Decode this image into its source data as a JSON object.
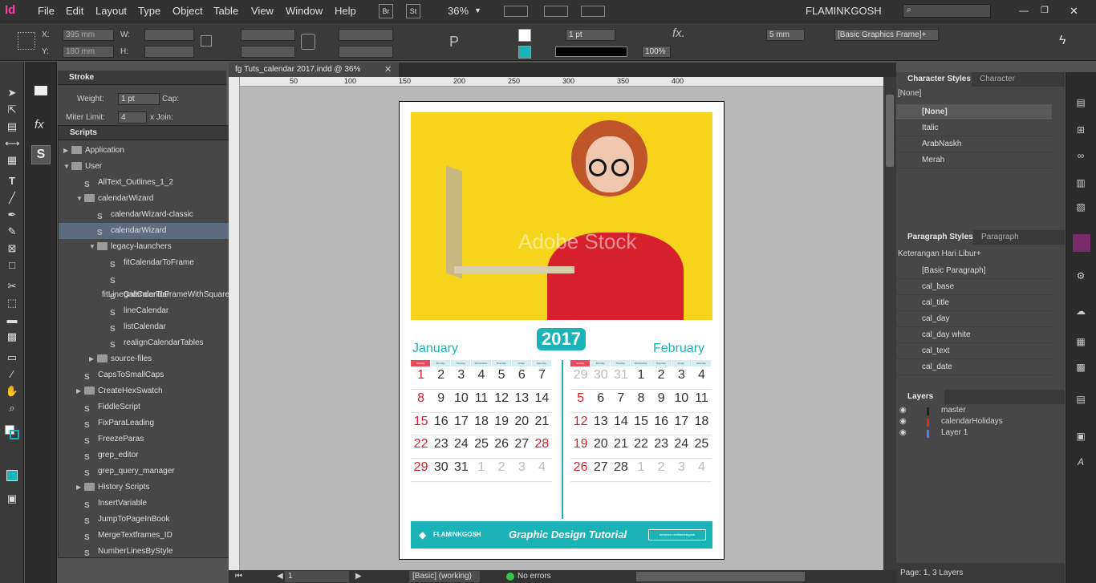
{
  "app": {
    "logo": "Id",
    "zoom": "36%",
    "workspace": "FLAMINKGOSH",
    "bridge_btn": "Br",
    "stock_btn": "St"
  },
  "menu": [
    "File",
    "Edit",
    "Layout",
    "Type",
    "Object",
    "Table",
    "View",
    "Window",
    "Help"
  ],
  "control": {
    "x_label": "X:",
    "x_value": "395 mm",
    "y_label": "Y:",
    "y_value": "180 mm",
    "w_label": "W:",
    "h_label": "H:",
    "stroke_weight": "1 pt",
    "stroke_weight_right": "5 mm",
    "frame_style": "[Basic Graphics Frame]+",
    "opacity": "100%"
  },
  "stroke_panel": {
    "title": "Stroke",
    "weight_label": "Weight:",
    "weight_value": "1 pt",
    "cap_label": "Cap:",
    "miter_label": "Miter Limit:",
    "miter_value": "4",
    "join_label": "x  Join:"
  },
  "scripts_panel": {
    "title": "Scripts",
    "items": [
      {
        "label": "Application",
        "kind": "folder",
        "indent": 0,
        "expanded": false
      },
      {
        "label": "User",
        "kind": "folder",
        "indent": 0,
        "expanded": true
      },
      {
        "label": "AllText_Outlines_1_2",
        "kind": "script",
        "indent": 1
      },
      {
        "label": "calendarWizard",
        "kind": "folder",
        "indent": 1,
        "expanded": true
      },
      {
        "label": "calendarWizard-classic",
        "kind": "script",
        "indent": 2
      },
      {
        "label": "calendarWizard",
        "kind": "script",
        "indent": 2,
        "selected": true
      },
      {
        "label": "legacy-launchers",
        "kind": "folder",
        "indent": 2,
        "expanded": true
      },
      {
        "label": "fitCalendarToFrame",
        "kind": "script",
        "indent": 3
      },
      {
        "label": "fitLineCalendarToFrameWithSquareCells",
        "kind": "script",
        "indent": 3
      },
      {
        "label": "gridCalendar",
        "kind": "script",
        "indent": 3
      },
      {
        "label": "lineCalendar",
        "kind": "script",
        "indent": 3
      },
      {
        "label": "listCalendar",
        "kind": "script",
        "indent": 3
      },
      {
        "label": "realignCalendarTables",
        "kind": "script",
        "indent": 3
      },
      {
        "label": "source-files",
        "kind": "folder",
        "indent": 2,
        "expanded": false
      },
      {
        "label": "CapsToSmallCaps",
        "kind": "script",
        "indent": 1
      },
      {
        "label": "CreateHexSwatch",
        "kind": "folder",
        "indent": 1,
        "expanded": false
      },
      {
        "label": "FiddleScript",
        "kind": "script",
        "indent": 1
      },
      {
        "label": "FixParaLeading",
        "kind": "script",
        "indent": 1
      },
      {
        "label": "FreezeParas",
        "kind": "script",
        "indent": 1
      },
      {
        "label": "grep_editor",
        "kind": "script",
        "indent": 1
      },
      {
        "label": "grep_query_manager",
        "kind": "script",
        "indent": 1
      },
      {
        "label": "History Scripts",
        "kind": "folder",
        "indent": 1,
        "expanded": false
      },
      {
        "label": "InsertVariable",
        "kind": "script",
        "indent": 1
      },
      {
        "label": "JumpToPageInBook",
        "kind": "script",
        "indent": 1
      },
      {
        "label": "MergeTextframes_ID",
        "kind": "script",
        "indent": 1
      },
      {
        "label": "NumberLinesByStyle",
        "kind": "script",
        "indent": 1
      }
    ]
  },
  "document": {
    "tab_title": "fg Tuts_calendar 2017.indd @ 36%",
    "ruler_ticks": [
      "50",
      "100",
      "150",
      "200",
      "250",
      "300",
      "350",
      "400"
    ],
    "page_number": "1",
    "style": "[Basic] (working)",
    "errors": "No errors"
  },
  "calendar": {
    "year": "2017",
    "watermark": "Adobe Stock",
    "weekdays": [
      "Sunday",
      "Monday",
      "Tuesday",
      "Wednesday",
      "Thursday",
      "Friday",
      "Saturday"
    ],
    "months": [
      {
        "name": "January",
        "days": [
          "1",
          "2",
          "3",
          "4",
          "5",
          "6",
          "7",
          "8",
          "9",
          "10",
          "11",
          "12",
          "13",
          "14",
          "15",
          "16",
          "17",
          "18",
          "19",
          "20",
          "21",
          "22",
          "23",
          "24",
          "25",
          "26",
          "27",
          "28",
          "29",
          "30",
          "31",
          "1",
          "2",
          "3",
          "4"
        ],
        "red": [
          0,
          7,
          14,
          21,
          27,
          28
        ],
        "grey": [
          31,
          32,
          33,
          34
        ]
      },
      {
        "name": "February",
        "days": [
          "29",
          "30",
          "31",
          "1",
          "2",
          "3",
          "4",
          "5",
          "6",
          "7",
          "8",
          "9",
          "10",
          "11",
          "12",
          "13",
          "14",
          "15",
          "16",
          "17",
          "18",
          "19",
          "20",
          "21",
          "22",
          "23",
          "24",
          "25",
          "26",
          "27",
          "28",
          "1",
          "2",
          "3",
          "4"
        ],
        "red": [
          7,
          14,
          21,
          28
        ],
        "grey": [
          0,
          1,
          2,
          31,
          32,
          33,
          34
        ]
      }
    ],
    "footer_brand": "FLAMINKGOSH",
    "footer_tagline": "Graphic Design Tutorial",
    "footer_link": "behance.net/flaminkgosh"
  },
  "character_styles": {
    "tabs": [
      "Character Styles",
      "Character"
    ],
    "current": "[None]",
    "items": [
      "[None]",
      "Italic",
      "ArabNaskh",
      "Merah"
    ]
  },
  "paragraph_styles": {
    "tabs": [
      "Paragraph Styles",
      "Paragraph"
    ],
    "current": "Keterangan Hari Libur+",
    "items": [
      "[Basic Paragraph]",
      "cal_base",
      "cal_title",
      "cal_day",
      "cal_day white",
      "cal_text",
      "cal_date"
    ]
  },
  "layers": {
    "title": "Layers",
    "items": [
      {
        "name": "master",
        "color": "#222222"
      },
      {
        "name": "calendarHolidays",
        "color": "#e8201a"
      },
      {
        "name": "Layer 1",
        "color": "#4a7ff5"
      }
    ],
    "footer": "Page: 1, 3 Layers"
  },
  "colors": {
    "accent": "#1ab3b8",
    "holiday": "#d81e2a",
    "photo_bg": "#f7d41c"
  }
}
